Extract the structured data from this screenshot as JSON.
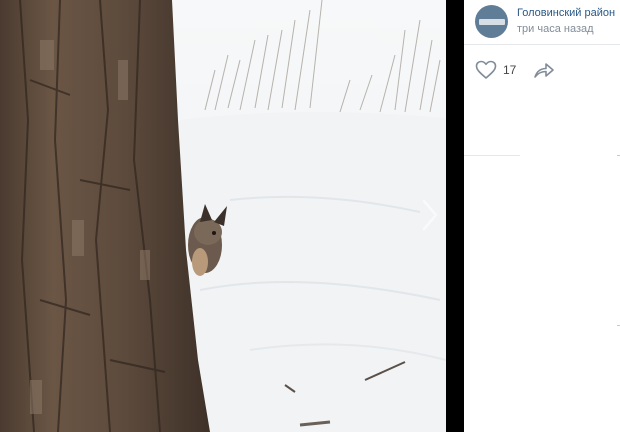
{
  "post": {
    "author": "Головинский район",
    "time": "три часа назад"
  },
  "actions": {
    "likes": "17"
  },
  "icons": {
    "like": "heart-outline-icon",
    "share": "share-arrow-icon",
    "next": "chevron-right-icon"
  },
  "colors": {
    "author_link": "#2a5885",
    "secondary_text": "#818c99",
    "avatar_bg": "#607d97"
  }
}
